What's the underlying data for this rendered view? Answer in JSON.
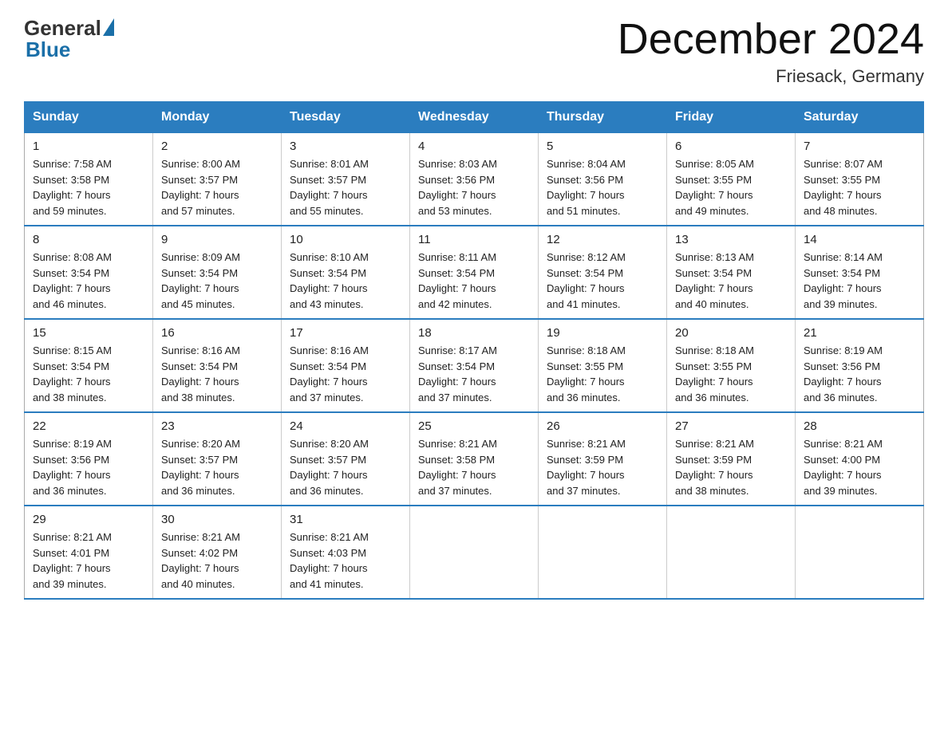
{
  "header": {
    "logo_general": "General",
    "logo_blue": "Blue",
    "month_title": "December 2024",
    "location": "Friesack, Germany"
  },
  "weekdays": [
    "Sunday",
    "Monday",
    "Tuesday",
    "Wednesday",
    "Thursday",
    "Friday",
    "Saturday"
  ],
  "weeks": [
    [
      {
        "day": "1",
        "sunrise": "7:58 AM",
        "sunset": "3:58 PM",
        "daylight": "7 hours and 59 minutes."
      },
      {
        "day": "2",
        "sunrise": "8:00 AM",
        "sunset": "3:57 PM",
        "daylight": "7 hours and 57 minutes."
      },
      {
        "day": "3",
        "sunrise": "8:01 AM",
        "sunset": "3:57 PM",
        "daylight": "7 hours and 55 minutes."
      },
      {
        "day": "4",
        "sunrise": "8:03 AM",
        "sunset": "3:56 PM",
        "daylight": "7 hours and 53 minutes."
      },
      {
        "day": "5",
        "sunrise": "8:04 AM",
        "sunset": "3:56 PM",
        "daylight": "7 hours and 51 minutes."
      },
      {
        "day": "6",
        "sunrise": "8:05 AM",
        "sunset": "3:55 PM",
        "daylight": "7 hours and 49 minutes."
      },
      {
        "day": "7",
        "sunrise": "8:07 AM",
        "sunset": "3:55 PM",
        "daylight": "7 hours and 48 minutes."
      }
    ],
    [
      {
        "day": "8",
        "sunrise": "8:08 AM",
        "sunset": "3:54 PM",
        "daylight": "7 hours and 46 minutes."
      },
      {
        "day": "9",
        "sunrise": "8:09 AM",
        "sunset": "3:54 PM",
        "daylight": "7 hours and 45 minutes."
      },
      {
        "day": "10",
        "sunrise": "8:10 AM",
        "sunset": "3:54 PM",
        "daylight": "7 hours and 43 minutes."
      },
      {
        "day": "11",
        "sunrise": "8:11 AM",
        "sunset": "3:54 PM",
        "daylight": "7 hours and 42 minutes."
      },
      {
        "day": "12",
        "sunrise": "8:12 AM",
        "sunset": "3:54 PM",
        "daylight": "7 hours and 41 minutes."
      },
      {
        "day": "13",
        "sunrise": "8:13 AM",
        "sunset": "3:54 PM",
        "daylight": "7 hours and 40 minutes."
      },
      {
        "day": "14",
        "sunrise": "8:14 AM",
        "sunset": "3:54 PM",
        "daylight": "7 hours and 39 minutes."
      }
    ],
    [
      {
        "day": "15",
        "sunrise": "8:15 AM",
        "sunset": "3:54 PM",
        "daylight": "7 hours and 38 minutes."
      },
      {
        "day": "16",
        "sunrise": "8:16 AM",
        "sunset": "3:54 PM",
        "daylight": "7 hours and 38 minutes."
      },
      {
        "day": "17",
        "sunrise": "8:16 AM",
        "sunset": "3:54 PM",
        "daylight": "7 hours and 37 minutes."
      },
      {
        "day": "18",
        "sunrise": "8:17 AM",
        "sunset": "3:54 PM",
        "daylight": "7 hours and 37 minutes."
      },
      {
        "day": "19",
        "sunrise": "8:18 AM",
        "sunset": "3:55 PM",
        "daylight": "7 hours and 36 minutes."
      },
      {
        "day": "20",
        "sunrise": "8:18 AM",
        "sunset": "3:55 PM",
        "daylight": "7 hours and 36 minutes."
      },
      {
        "day": "21",
        "sunrise": "8:19 AM",
        "sunset": "3:56 PM",
        "daylight": "7 hours and 36 minutes."
      }
    ],
    [
      {
        "day": "22",
        "sunrise": "8:19 AM",
        "sunset": "3:56 PM",
        "daylight": "7 hours and 36 minutes."
      },
      {
        "day": "23",
        "sunrise": "8:20 AM",
        "sunset": "3:57 PM",
        "daylight": "7 hours and 36 minutes."
      },
      {
        "day": "24",
        "sunrise": "8:20 AM",
        "sunset": "3:57 PM",
        "daylight": "7 hours and 36 minutes."
      },
      {
        "day": "25",
        "sunrise": "8:21 AM",
        "sunset": "3:58 PM",
        "daylight": "7 hours and 37 minutes."
      },
      {
        "day": "26",
        "sunrise": "8:21 AM",
        "sunset": "3:59 PM",
        "daylight": "7 hours and 37 minutes."
      },
      {
        "day": "27",
        "sunrise": "8:21 AM",
        "sunset": "3:59 PM",
        "daylight": "7 hours and 38 minutes."
      },
      {
        "day": "28",
        "sunrise": "8:21 AM",
        "sunset": "4:00 PM",
        "daylight": "7 hours and 39 minutes."
      }
    ],
    [
      {
        "day": "29",
        "sunrise": "8:21 AM",
        "sunset": "4:01 PM",
        "daylight": "7 hours and 39 minutes."
      },
      {
        "day": "30",
        "sunrise": "8:21 AM",
        "sunset": "4:02 PM",
        "daylight": "7 hours and 40 minutes."
      },
      {
        "day": "31",
        "sunrise": "8:21 AM",
        "sunset": "4:03 PM",
        "daylight": "7 hours and 41 minutes."
      },
      null,
      null,
      null,
      null
    ]
  ],
  "labels": {
    "sunrise": "Sunrise:",
    "sunset": "Sunset:",
    "daylight": "Daylight:"
  }
}
